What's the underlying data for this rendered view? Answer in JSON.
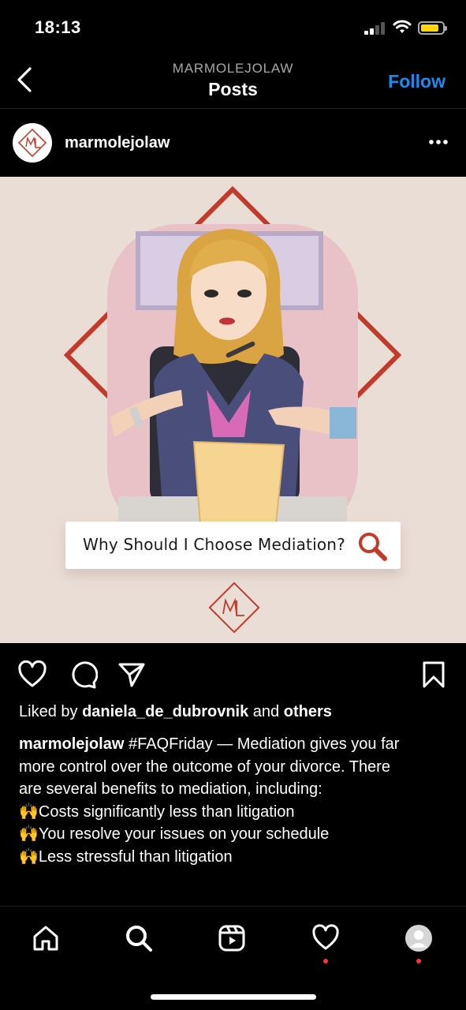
{
  "status_bar": {
    "time": "18:13"
  },
  "header": {
    "account": "MARMOLEJOLAW",
    "title": "Posts",
    "follow_label": "Follow"
  },
  "post": {
    "username": "marmolejolaw",
    "avatar_monogram": "ML",
    "image": {
      "card_text": "Why Should I Choose Mediation?",
      "logo_monogram": "ML",
      "colors": {
        "background": "#eaddd5",
        "diamond": "#c23b2a",
        "pink_panel": "#e8c2c6"
      }
    },
    "likes": {
      "prefix": "Liked by",
      "user": "daniela_de_dubrovnik",
      "middle": "and",
      "others": "others"
    },
    "caption": {
      "username": "marmolejolaw",
      "line1": "#FAQFriday — Mediation gives you far",
      "line2": "more control over the outcome of your divorce. There",
      "line3": "are several benefits to mediation, including:",
      "bullets": [
        {
          "emoji": "🙌",
          "text": "Costs significantly less than litigation"
        },
        {
          "emoji": "🙌",
          "text": "You resolve your issues on your schedule"
        },
        {
          "emoji": "🙌",
          "text": "Less stressful than litigation"
        }
      ]
    }
  },
  "icons": [
    "back-icon",
    "more-icon",
    "heart-icon",
    "comment-icon",
    "share-icon",
    "bookmark-icon",
    "home-icon",
    "search-icon",
    "reels-icon",
    "activity-heart-icon",
    "profile-avatar"
  ],
  "accent_colors": {
    "follow": "#1a8cf0",
    "notification_dot": "#ff3040",
    "battery": "#ffd60a"
  }
}
